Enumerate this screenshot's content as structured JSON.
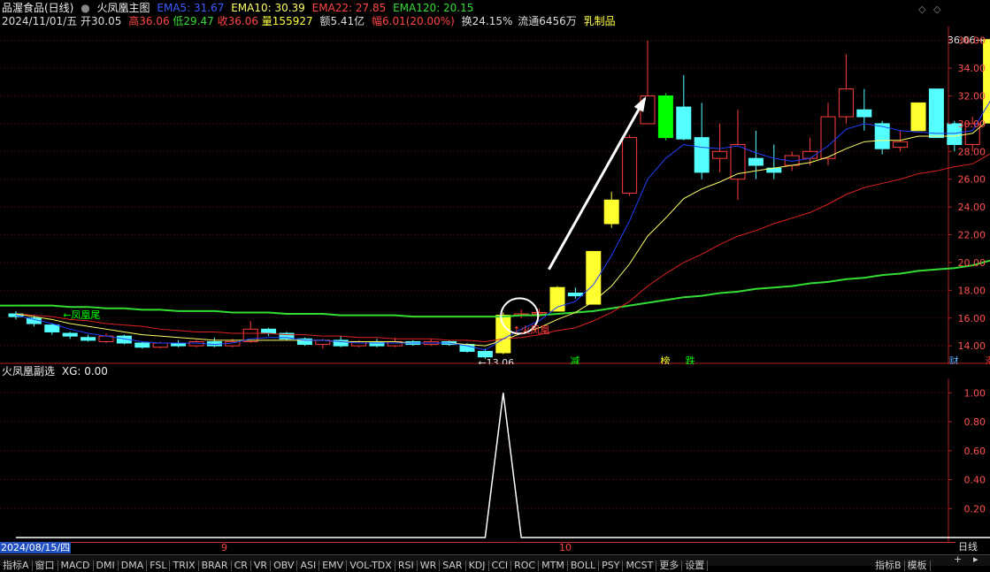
{
  "header": {
    "stock": "品渥食品(日线)",
    "indicator": "火凤凰主图",
    "ema5": "EMA5: 31.67",
    "ema10": "EMA10: 30.39",
    "ema22": "EMA22: 27.85",
    "ema120": "EMA120: 20.15",
    "date": "2024/11/01/五",
    "open": "开30.05",
    "high": "高36.06",
    "low": "低29.47",
    "close": "收36.06",
    "volume": "量155927",
    "amount": "额5.41亿",
    "change": "幅6.01(20.00%)",
    "turnover": "换24.15%",
    "float": "流通6456万",
    "sector": "乳制品"
  },
  "colors": {
    "up": "#ff3c3c",
    "down": "#54ffff",
    "yellow": "#ffff2e",
    "green": "#00ff00",
    "ema5": "#2040ff",
    "ema10": "#ffff66",
    "ema22": "#dd2222",
    "ema120": "#33dd33"
  },
  "annotations": {
    "tail": "凤凰尾",
    "fire": "火凤凰",
    "low_label": "13.06",
    "high_label": "36.06",
    "sig1": "减",
    "sig2": "榜",
    "sig3": "跌",
    "sig4": "财",
    "sig5": "涨"
  },
  "subchart": {
    "title": "火凤凰副选",
    "xg": "XG: 0.00"
  },
  "datebar": {
    "cursor_date": "2024/08/15/四",
    "m9": "9",
    "m10": "10",
    "period": "日线"
  },
  "tabs": [
    "指标A",
    "窗口",
    "MACD",
    "DMI",
    "DMA",
    "FSL",
    "TRIX",
    "BRAR",
    "CR",
    "VR",
    "OBV",
    "ASI",
    "EMV",
    "VOL-TDX",
    "RSI",
    "WR",
    "SAR",
    "KDJ",
    "CCI",
    "ROC",
    "MTM",
    "BOLL",
    "PSY",
    "MCST",
    "更多",
    "设置"
  ],
  "tabs_right": [
    "指标B",
    "模板"
  ],
  "chart_data": [
    {
      "type": "candlestick",
      "title": "火凤凰主图",
      "ylim": [
        12.8,
        37.0
      ],
      "yticks": [
        14,
        16,
        18,
        20,
        22,
        24,
        26,
        28,
        30,
        32,
        34,
        36
      ],
      "candles": [
        {
          "o": 16.3,
          "c": 16.1,
          "h": 16.5,
          "l": 15.9
        },
        {
          "o": 16.0,
          "c": 15.6,
          "h": 16.2,
          "l": 15.4
        },
        {
          "o": 15.5,
          "c": 15.0,
          "h": 15.6,
          "l": 14.8
        },
        {
          "o": 14.9,
          "c": 14.7,
          "h": 15.0,
          "l": 14.5
        },
        {
          "o": 14.6,
          "c": 14.4,
          "h": 14.8,
          "l": 14.3
        },
        {
          "o": 14.3,
          "c": 14.7,
          "h": 14.9,
          "l": 14.2
        },
        {
          "o": 14.7,
          "c": 14.2,
          "h": 14.8,
          "l": 14.1
        },
        {
          "o": 14.2,
          "c": 13.9,
          "h": 14.3,
          "l": 13.8
        },
        {
          "o": 13.9,
          "c": 14.2,
          "h": 14.3,
          "l": 13.8
        },
        {
          "o": 14.2,
          "c": 14.0,
          "h": 14.4,
          "l": 13.9
        },
        {
          "o": 14.0,
          "c": 14.3,
          "h": 14.4,
          "l": 13.9
        },
        {
          "o": 14.3,
          "c": 14.0,
          "h": 14.6,
          "l": 13.9
        },
        {
          "o": 14.0,
          "c": 14.3,
          "h": 14.5,
          "l": 13.9
        },
        {
          "o": 14.3,
          "c": 15.2,
          "h": 15.8,
          "l": 14.2
        },
        {
          "o": 15.2,
          "c": 14.9,
          "h": 15.3,
          "l": 14.7
        },
        {
          "o": 14.9,
          "c": 14.5,
          "h": 15.0,
          "l": 14.4
        },
        {
          "o": 14.5,
          "c": 14.1,
          "h": 14.6,
          "l": 14.0
        },
        {
          "o": 14.1,
          "c": 14.4,
          "h": 14.5,
          "l": 13.8
        },
        {
          "o": 14.4,
          "c": 14.0,
          "h": 14.7,
          "l": 13.9
        },
        {
          "o": 14.0,
          "c": 14.3,
          "h": 14.4,
          "l": 13.9
        },
        {
          "o": 14.3,
          "c": 14.0,
          "h": 14.5,
          "l": 13.9
        },
        {
          "o": 14.0,
          "c": 14.3,
          "h": 14.6,
          "l": 13.9
        },
        {
          "o": 14.3,
          "c": 14.1,
          "h": 14.4,
          "l": 14.0
        },
        {
          "o": 14.1,
          "c": 14.3,
          "h": 14.5,
          "l": 14.0
        },
        {
          "o": 14.3,
          "c": 14.1,
          "h": 14.4,
          "l": 14.0
        },
        {
          "o": 14.1,
          "c": 13.6,
          "h": 14.2,
          "l": 13.5
        },
        {
          "o": 13.6,
          "c": 13.2,
          "h": 13.8,
          "l": 13.06
        },
        {
          "o": 13.5,
          "c": 16.2,
          "h": 16.4,
          "l": 13.4
        },
        {
          "o": 16.2,
          "c": 16.3,
          "h": 16.6,
          "l": 16.0
        },
        {
          "o": 16.3,
          "c": 16.4,
          "h": 16.7,
          "l": 16.1
        },
        {
          "o": 16.5,
          "c": 18.2,
          "h": 18.3,
          "l": 16.5
        },
        {
          "o": 17.8,
          "c": 17.6,
          "h": 18.2,
          "l": 17.4
        },
        {
          "o": 17.0,
          "c": 20.8,
          "h": 20.8,
          "l": 17.0
        },
        {
          "o": 22.8,
          "c": 24.5,
          "h": 25.1,
          "l": 22.5
        },
        {
          "o": 25.0,
          "c": 29.0,
          "h": 29.2,
          "l": 24.8
        },
        {
          "o": 30.0,
          "c": 32.0,
          "h": 36.0,
          "l": 30.0
        },
        {
          "o": 32.0,
          "c": 29.0,
          "h": 32.2,
          "l": 28.8
        },
        {
          "o": 31.2,
          "c": 28.9,
          "h": 33.5,
          "l": 28.8
        },
        {
          "o": 29.0,
          "c": 26.5,
          "h": 31.5,
          "l": 26.0
        },
        {
          "o": 27.5,
          "c": 28.0,
          "h": 30.0,
          "l": 26.5
        },
        {
          "o": 26.0,
          "c": 28.5,
          "h": 31.0,
          "l": 24.5
        },
        {
          "o": 27.5,
          "c": 27.0,
          "h": 29.5,
          "l": 26.0
        },
        {
          "o": 26.8,
          "c": 26.5,
          "h": 28.5,
          "l": 26.0
        },
        {
          "o": 27.0,
          "c": 27.7,
          "h": 28.0,
          "l": 26.6
        },
        {
          "o": 27.5,
          "c": 28.0,
          "h": 29.0,
          "l": 27.0
        },
        {
          "o": 27.5,
          "c": 30.5,
          "h": 31.5,
          "l": 27.0
        },
        {
          "o": 30.5,
          "c": 32.5,
          "h": 35.0,
          "l": 30.0
        },
        {
          "o": 31.0,
          "c": 30.5,
          "h": 32.5,
          "l": 29.5
        },
        {
          "o": 30.0,
          "c": 28.2,
          "h": 30.2,
          "l": 27.8
        },
        {
          "o": 28.3,
          "c": 28.7,
          "h": 29.5,
          "l": 28.0
        },
        {
          "o": 29.5,
          "c": 31.5,
          "h": 31.5,
          "l": 29.5
        },
        {
          "o": 32.5,
          "c": 29.0,
          "h": 32.5,
          "l": 29.0
        },
        {
          "o": 30.0,
          "c": 28.5,
          "h": 30.2,
          "l": 28.0
        },
        {
          "o": 28.5,
          "c": 30.0,
          "h": 30.5,
          "l": 28.0
        },
        {
          "o": 30.05,
          "c": 36.06,
          "h": 36.06,
          "l": 29.47
        }
      ],
      "fill_color": [
        "",
        "",
        "",
        "",
        "",
        "",
        "",
        "",
        "",
        "",
        "",
        "",
        "",
        "",
        "",
        "",
        "",
        "",
        "",
        "",
        "",
        "",
        "",
        "",
        "",
        "",
        "",
        "yellow",
        "",
        "",
        "yellow",
        "",
        "yellow",
        "yellow",
        "",
        "",
        "green",
        "",
        "",
        "",
        "",
        "",
        "",
        "",
        "",
        "",
        "",
        "",
        "",
        "",
        "yellow",
        "",
        "",
        "",
        "yellow"
      ],
      "ema5": [
        16.2,
        15.9,
        15.6,
        15.2,
        14.9,
        14.7,
        14.5,
        14.3,
        14.2,
        14.2,
        14.2,
        14.1,
        14.2,
        14.5,
        14.6,
        14.6,
        14.4,
        14.4,
        14.3,
        14.2,
        14.2,
        14.2,
        14.2,
        14.2,
        14.2,
        14.0,
        13.7,
        14.5,
        15.2,
        15.8,
        16.8,
        17.2,
        18.4,
        20.5,
        23.0,
        26.0,
        27.5,
        28.5,
        28.3,
        28.2,
        28.4,
        27.9,
        27.5,
        27.3,
        27.5,
        28.4,
        29.6,
        30.0,
        29.8,
        29.5,
        29.4,
        29.3,
        29.3,
        29.5,
        31.67
      ],
      "ema10": [
        16.3,
        16.1,
        15.9,
        15.6,
        15.4,
        15.2,
        15.0,
        14.8,
        14.7,
        14.6,
        14.5,
        14.4,
        14.4,
        14.4,
        14.4,
        14.4,
        14.4,
        14.4,
        14.3,
        14.3,
        14.3,
        14.3,
        14.2,
        14.2,
        14.2,
        14.1,
        14.0,
        14.4,
        14.9,
        15.3,
        15.9,
        16.4,
        17.2,
        18.3,
        19.9,
        21.9,
        23.2,
        24.6,
        25.3,
        25.8,
        26.4,
        26.6,
        26.8,
        27.0,
        27.2,
        27.6,
        28.2,
        28.7,
        28.8,
        28.8,
        29.1,
        29.1,
        29.1,
        29.3,
        30.39
      ],
      "ema22": [
        16.3,
        16.2,
        16.1,
        15.9,
        15.8,
        15.6,
        15.5,
        15.4,
        15.2,
        15.1,
        15.0,
        15.0,
        14.9,
        14.9,
        14.9,
        14.8,
        14.8,
        14.7,
        14.7,
        14.6,
        14.6,
        14.5,
        14.5,
        14.5,
        14.4,
        14.4,
        14.3,
        14.5,
        14.6,
        14.8,
        15.1,
        15.3,
        15.8,
        16.4,
        17.2,
        18.3,
        19.2,
        20.0,
        20.6,
        21.3,
        21.9,
        22.3,
        22.8,
        23.2,
        23.6,
        24.2,
        24.9,
        25.4,
        25.7,
        26.0,
        26.4,
        26.6,
        26.9,
        27.1,
        27.85
      ],
      "ema120": [
        16.9,
        16.9,
        16.9,
        16.8,
        16.8,
        16.7,
        16.7,
        16.6,
        16.6,
        16.5,
        16.5,
        16.5,
        16.4,
        16.4,
        16.4,
        16.3,
        16.3,
        16.3,
        16.2,
        16.2,
        16.2,
        16.2,
        16.1,
        16.1,
        16.1,
        16.1,
        16.1,
        16.1,
        16.2,
        16.2,
        16.3,
        16.4,
        16.5,
        16.7,
        16.9,
        17.1,
        17.3,
        17.5,
        17.6,
        17.8,
        17.9,
        18.1,
        18.2,
        18.3,
        18.5,
        18.6,
        18.8,
        18.9,
        19.1,
        19.2,
        19.4,
        19.5,
        19.6,
        19.8,
        20.15
      ]
    },
    {
      "type": "line",
      "title": "火凤凰副选",
      "series": [
        {
          "name": "XG",
          "values": [
            0,
            0,
            0,
            0,
            0,
            0,
            0,
            0,
            0,
            0,
            0,
            0,
            0,
            0,
            0,
            0,
            0,
            0,
            0,
            0,
            0,
            0,
            0,
            0,
            0,
            0,
            0,
            1,
            0,
            0,
            0,
            0,
            0,
            0,
            0,
            0,
            0,
            0,
            0,
            0,
            0,
            0,
            0,
            0,
            0,
            0,
            0,
            0,
            0,
            0,
            0,
            0,
            0,
            0,
            0
          ]
        }
      ],
      "ylim": [
        0,
        1.1
      ],
      "yticks": [
        0.2,
        0.4,
        0.6,
        0.8,
        1.0
      ]
    }
  ]
}
